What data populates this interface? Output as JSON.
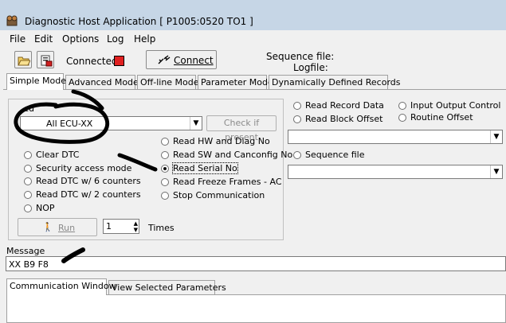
{
  "window": {
    "title": "Diagnostic Host Application [ P1005:0520 TO1 ]",
    "colors": {
      "titlebar": "#c6d6e6",
      "led": "#e02020"
    }
  },
  "menu": [
    "File",
    "Edit",
    "Options",
    "Log",
    "Help"
  ],
  "toolbar": {
    "open_icon": "folder-open-icon",
    "save_icon": "save-icon",
    "status_label": "Connected",
    "connect_label": "Connect",
    "sequence_file_label": "Sequence file:",
    "logfile_label": "Logfile:"
  },
  "tabs": [
    "Simple Mode",
    "Advanced Mode",
    "Off-line Mode",
    "Parameter Mode",
    "Dynamically Defined Records"
  ],
  "ecu": {
    "group_label": "cu",
    "selected": "All ECU-XX",
    "check_button": "Check if present"
  },
  "left_options": [
    {
      "label": "Clear DTC"
    },
    {
      "label": "Security access mode"
    },
    {
      "label": "Read DTC w/ 6 counters"
    },
    {
      "label": "Read DTC w/ 2 counters"
    },
    {
      "label": "NOP"
    }
  ],
  "mid_options": [
    {
      "label": "Read HW and Diag No"
    },
    {
      "label": "Read SW and Canconfig No"
    },
    {
      "label": "Read Serial No",
      "selected": true
    },
    {
      "label": "Read Freeze Frames - AC"
    },
    {
      "label": "Stop Communication"
    }
  ],
  "right_options": [
    {
      "label": "Read Record Data"
    },
    {
      "label": "Read Block Offset"
    },
    {
      "label": "Input Output Control"
    },
    {
      "label": "Routine Offset"
    },
    {
      "label": "Sequence file"
    }
  ],
  "run": {
    "button_label": "Run",
    "count": "1",
    "times_label": "Times"
  },
  "message": {
    "label": "Message",
    "value": "XX B9 F8"
  },
  "bottom_tabs": [
    "Communication Window",
    "View Selected Parameters"
  ]
}
